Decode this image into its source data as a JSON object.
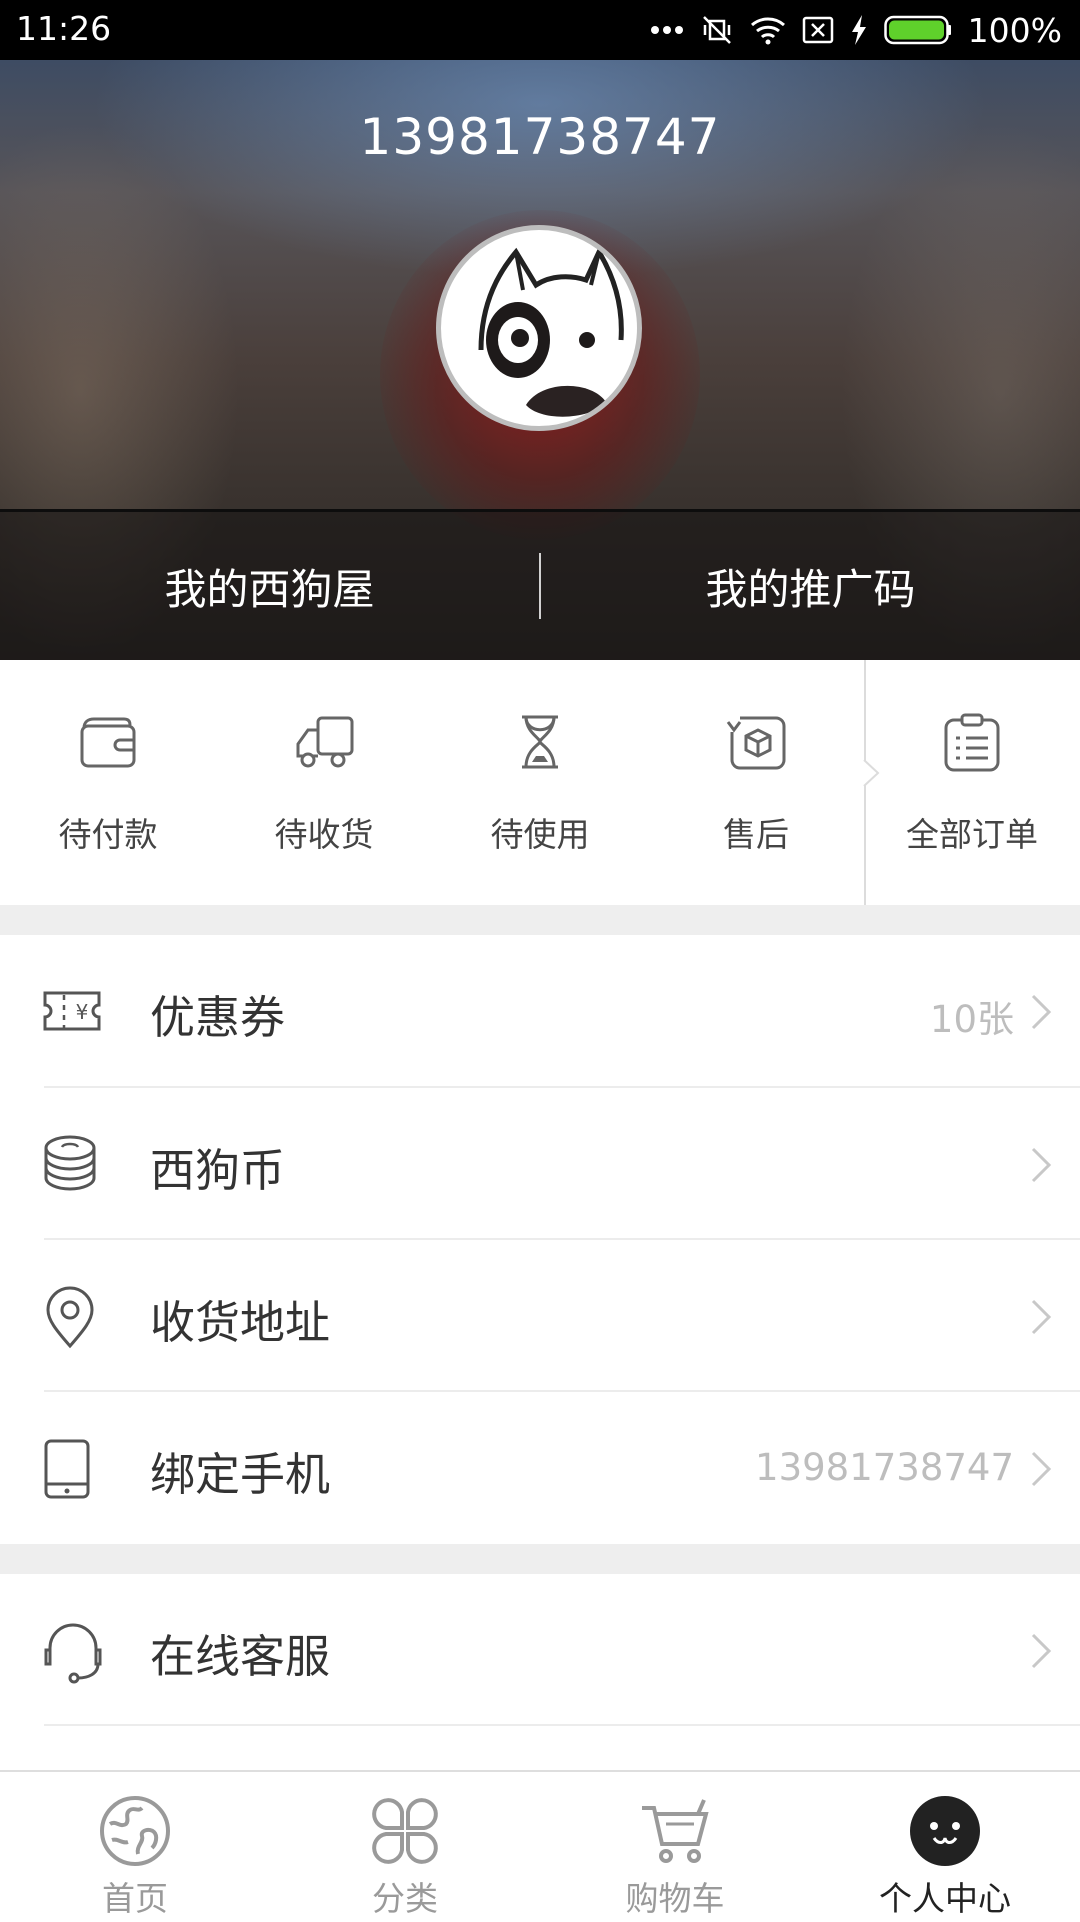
{
  "status_bar": {
    "time": "11:26",
    "battery": "100%",
    "icons": [
      "more-dots-icon",
      "vibrate-mute-icon",
      "wifi-icon",
      "no-sim-icon",
      "charging-bolt-icon",
      "battery-icon"
    ]
  },
  "header": {
    "phone": "13981738747",
    "links": [
      {
        "label": "我的西狗屋"
      },
      {
        "label": "我的推广码"
      }
    ]
  },
  "orders": [
    {
      "label": "待付款",
      "icon": "wallet-icon"
    },
    {
      "label": "待收货",
      "icon": "truck-icon"
    },
    {
      "label": "待使用",
      "icon": "hourglass-icon"
    },
    {
      "label": "售后",
      "icon": "return-box-icon"
    },
    {
      "label": "全部订单",
      "icon": "order-list-icon"
    }
  ],
  "menu": [
    {
      "label": "优惠券",
      "value": "10张",
      "icon": "coupon-icon"
    },
    {
      "label": "西狗币",
      "value": "",
      "icon": "coins-icon"
    },
    {
      "label": "收货地址",
      "value": "",
      "icon": "location-pin-icon"
    },
    {
      "label": "绑定手机",
      "value": "13981738747",
      "icon": "mobile-phone-icon"
    }
  ],
  "menu2": [
    {
      "label": "在线客服",
      "icon": "headset-icon"
    }
  ],
  "tabbar": {
    "active": "个人中心",
    "tabs": [
      {
        "label": "首页",
        "icon": "globe-icon"
      },
      {
        "label": "分类",
        "icon": "category-grid-icon"
      },
      {
        "label": "购物车",
        "icon": "cart-icon"
      },
      {
        "label": "个人中心",
        "icon": "profile-face-icon"
      }
    ]
  },
  "colors": {
    "accent_dark": "#222222",
    "muted_text": "#9a9a9a",
    "value_text": "#bdbdbd",
    "section_gap": "#eeeeee"
  }
}
